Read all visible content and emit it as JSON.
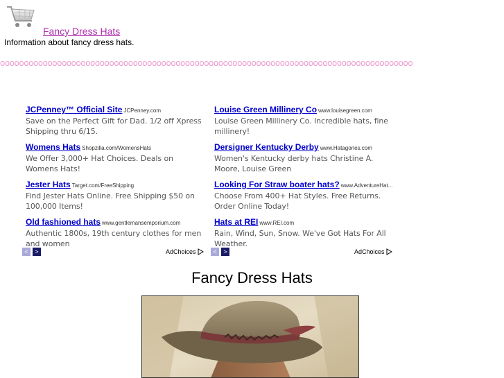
{
  "header": {
    "logo_icon": "shopping-cart-icon",
    "site_title": "Fancy Dress Hats",
    "site_description": "Information about fancy dress hats.",
    "border_pattern": "ooooooooooooooooooooooooooooooooooooooooooooooooooooooooooooooooooooooooooooooooooooooo",
    "border_color": "#ee9ed2"
  },
  "ads": {
    "left": [
      {
        "title": "JCPenney™ Official Site",
        "url": "JCPenney.com",
        "text": "Save on the Perfect Gift for Dad. 1/2 off Xpress Shipping thru 6/15."
      },
      {
        "title": "Womens Hats",
        "url": "Shopzilla.com/WomensHats",
        "text": "We Offer 3,000+ Hat Choices. Deals on Womens Hats!"
      },
      {
        "title": "Jester Hats",
        "url": "Target.com/FreeShipping",
        "text": "Find Jester Hats Online. Free Shipping $50 on 100,000 Items!"
      },
      {
        "title": "Old fashioned hats",
        "url": "www.gentlemansemporium.com",
        "text": "Authentic 1800s, 19th century clothes for men and women"
      }
    ],
    "right": [
      {
        "title": "Louise Green Millinery Co",
        "url": "www.louisegreen.com",
        "text": "Louise Green Millinery Co. Incredible hats, fine millinery!"
      },
      {
        "title": "Dersigner Kentucky Derby",
        "url": "www.Hatagories.com",
        "text": "Women's Kentucky derby hats Christine A. Moore, Louise Green"
      },
      {
        "title": "Looking For Straw boater hats?",
        "url": "www.AdventureHat...",
        "text": "Choose From 400+ Hat Styles. Free Returns. Order Online Today!"
      },
      {
        "title": "Hats at REI",
        "url": "www.REI.com",
        "text": "Rain, Wind, Sun, Snow. We've Got Hats For All Weather."
      }
    ],
    "nav_prev_glyph": "<",
    "nav_next_glyph": ">",
    "adchoices_label": "AdChoices",
    "title_color": "#0000cc"
  },
  "main": {
    "heading": "Fancy Dress Hats",
    "image_icon": "man-in-fedora-photo"
  }
}
